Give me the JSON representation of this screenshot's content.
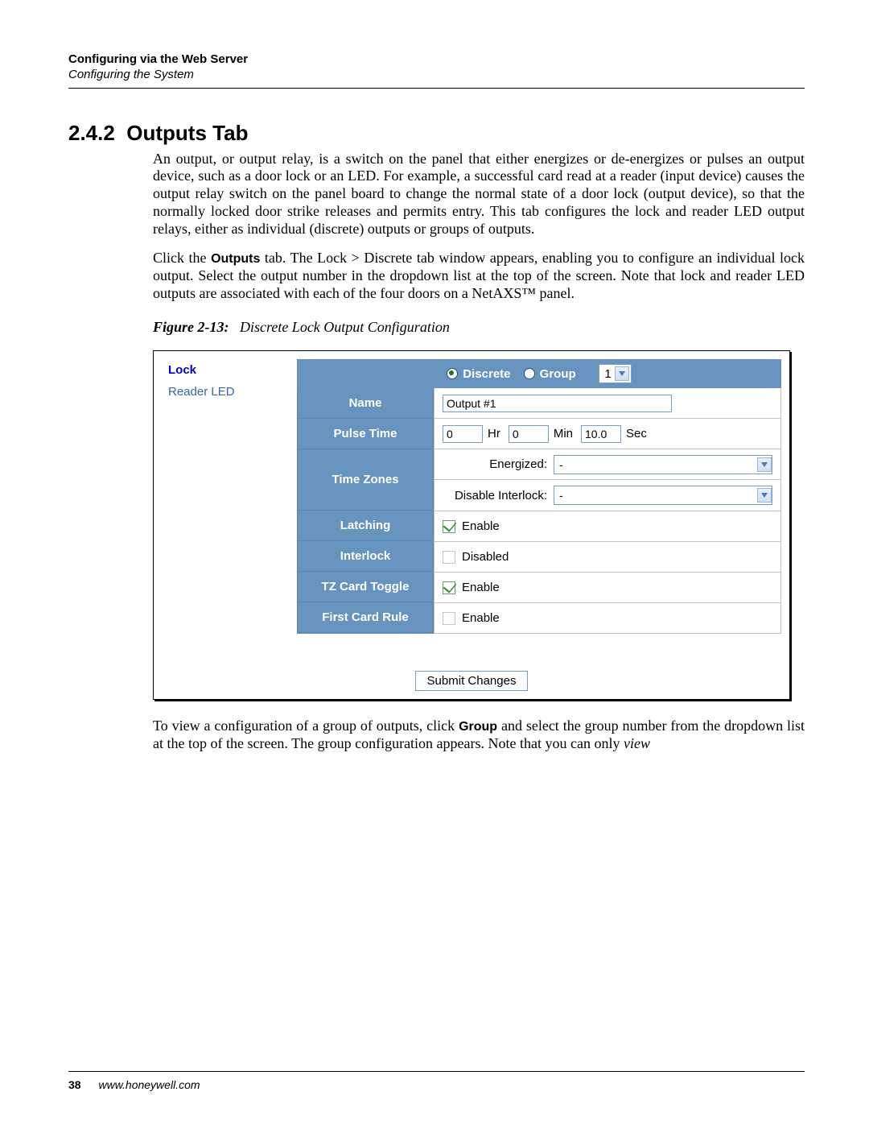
{
  "header": {
    "title": "Configuring via the Web Server",
    "subtitle": "Configuring the System"
  },
  "section": {
    "number": "2.4.2",
    "title": "Outputs Tab",
    "para1": "An output, or output relay, is a switch on the panel that either energizes or de-energizes or pulses an output device, such as a door lock or an LED. For example, a successful card read at a reader (input device) causes the output relay switch on the panel board to change the normal state of a door lock (output device), so that the normally locked door strike releases and permits entry. This tab configures the lock and reader LED output relays, either as individual (discrete) outputs or groups of outputs.",
    "para2_before": "Click the ",
    "para2_bold": "Outputs",
    "para2_after": " tab. The Lock > Discrete tab window appears, enabling you to configure an individual lock output. Select the output number in the dropdown list at the top of the screen. Note that lock and reader LED outputs are associated with each of the four doors on a NetAXS™ panel.",
    "para3_before": "To view a configuration of a group of outputs, click ",
    "para3_bold": "Group",
    "para3_after": " and select the group number from the dropdown list at the top of the screen. The group configuration appears. Note that you can only ",
    "para3_italic": "view"
  },
  "figure": {
    "label": "Figure 2-13:",
    "caption": "Discrete Lock Output Configuration"
  },
  "ui": {
    "sidebar_lock": "Lock",
    "sidebar_reader": "Reader LED",
    "radio_discrete": "Discrete",
    "radio_group": "Group",
    "select_value": "1",
    "rows": {
      "name_label": "Name",
      "name_value": "Output #1",
      "pulse_label": "Pulse Time",
      "pulse_hr": "0",
      "pulse_hr_unit": "Hr",
      "pulse_min": "0",
      "pulse_min_unit": "Min",
      "pulse_sec": "10.0",
      "pulse_sec_unit": "Sec",
      "tz_label": "Time Zones",
      "tz_energized": "Energized:",
      "tz_energized_val": "-",
      "tz_disable": "Disable Interlock:",
      "tz_disable_val": "-",
      "latching_label": "Latching",
      "latching_text": "Enable",
      "interlock_label": "Interlock",
      "interlock_text": "Disabled",
      "tzcard_label": "TZ Card Toggle",
      "tzcard_text": "Enable",
      "firstcard_label": "First Card Rule",
      "firstcard_text": "Enable"
    },
    "submit": "Submit Changes"
  },
  "footer": {
    "page": "38",
    "url": "www.honeywell.com"
  }
}
